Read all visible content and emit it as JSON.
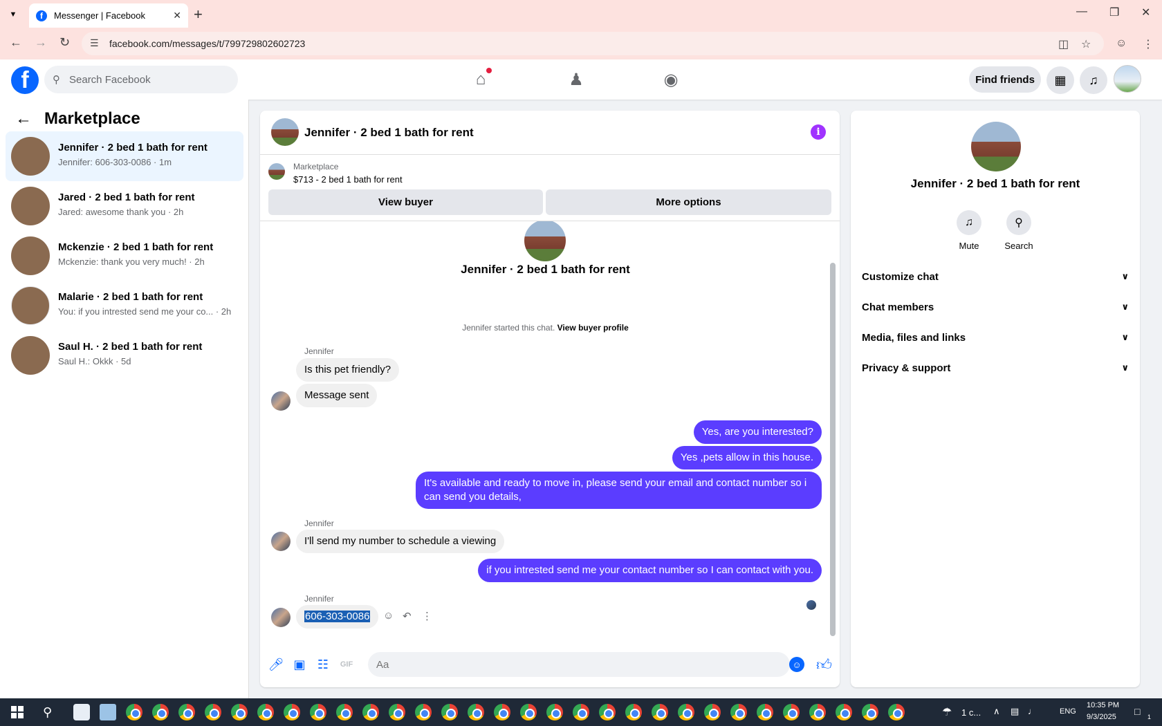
{
  "browser": {
    "tab_title": "Messenger | Facebook",
    "url": "facebook.com/messages/t/799729802602723"
  },
  "header": {
    "search_placeholder": "Search Facebook",
    "find_friends": "Find friends"
  },
  "sidebar": {
    "title": "Marketplace",
    "conversations": [
      {
        "title": "Jennifer · 2 bed 1 bath for rent",
        "subtitle": "Jennifer: 606-303-0086 · 1m"
      },
      {
        "title": "Jared · 2 bed 1 bath for rent",
        "subtitle": "Jared: awesome thank you · 2h"
      },
      {
        "title": "Mckenzie · 2 bed 1 bath for rent",
        "subtitle": "Mckenzie: thank you very much! · 2h"
      },
      {
        "title": "Malarie · 2 bed 1 bath for rent",
        "subtitle": "You: if you intrested send me your co... · 2h"
      },
      {
        "title": "Saul H. · 2 bed 1 bath for rent",
        "subtitle": "Saul H.: Okkk · 5d"
      }
    ]
  },
  "chat": {
    "title": "Jennifer · 2 bed 1 bath for rent",
    "listing_label": "Marketplace",
    "listing_price": "$713 - 2 bed 1 bath for rent",
    "view_buyer": "View buyer",
    "more_options": "More options",
    "intro_name": "Jennifer · 2 bed 1 bath for rent",
    "started_text": "Jennifer started this chat.",
    "view_buyer_profile": "View buyer profile",
    "sender_name": "Jennifer",
    "messages": {
      "in1": "Is this pet friendly?",
      "in2": "Message sent",
      "out1": "Yes, are you interested?",
      "out2": "Yes ,pets allow in this house.",
      "out3": "It's available and ready to move in, please send your email and contact number so i can send you details,",
      "in3": "I'll send my number to schedule a viewing",
      "out4": "if you intrested send me your contact number so I can contact with you.",
      "in4": "606-303-0086"
    },
    "composer_placeholder": "Aa"
  },
  "right_panel": {
    "name": "Jennifer · 2 bed 1 bath for rent",
    "mute": "Mute",
    "search": "Search",
    "sections": [
      "Customize chat",
      "Chat members",
      "Media, files and links",
      "Privacy & support"
    ]
  },
  "taskbar": {
    "weather": "1 c...",
    "lang": "ENG",
    "time": "10:35 PM",
    "date": "9/3/2025",
    "notif_count": "1"
  },
  "colors": {
    "fb_blue": "#0866ff",
    "outgoing_bubble": "#5b3dff",
    "info_purple": "#a033ff"
  }
}
